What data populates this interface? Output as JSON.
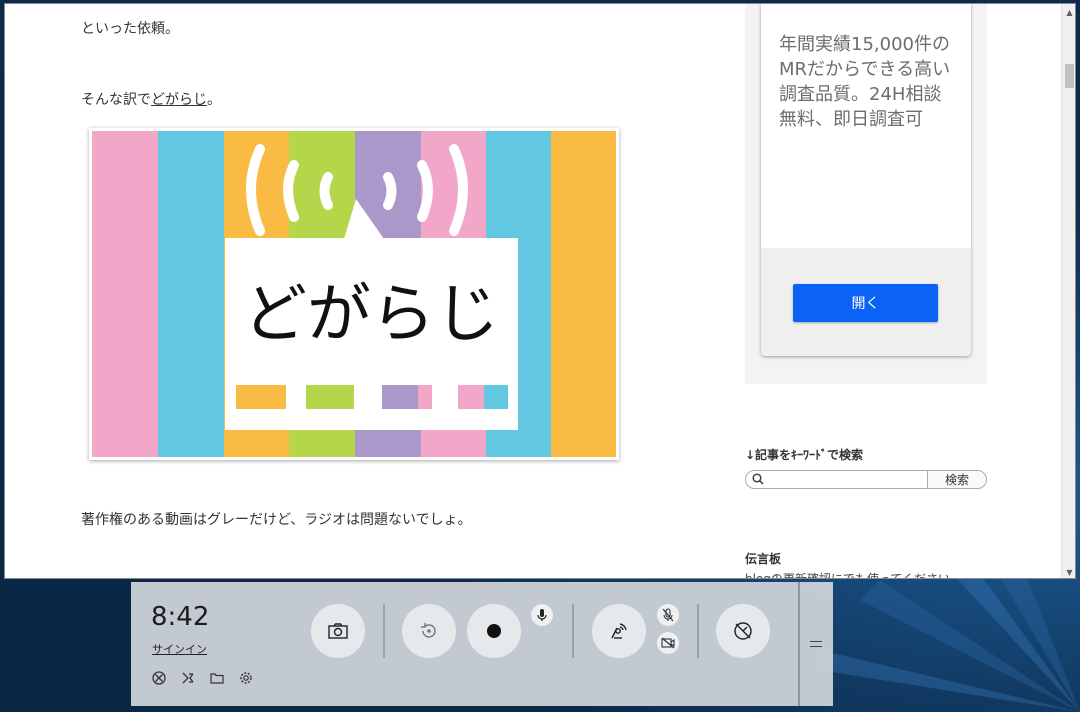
{
  "article": {
    "line1": "といった依頼。",
    "line2_prefix": "そんな訳で",
    "line2_link": "どがらじ",
    "line2_suffix": "。",
    "logo_text": "どがらじ",
    "line3": "著作権のある動画はグレーだけど、ラジオは問題ないでしょ。"
  },
  "ad": {
    "text": "年間実績15,000件のMRだからできる高い調査品質。24H相談無料、即日調査可",
    "button_label": "開く"
  },
  "sidebar": {
    "search_heading": "↓記事をｷｰﾜｰﾄﾞで検索",
    "search_placeholder": "",
    "search_button": "検索",
    "board_heading": "伝言板",
    "board_text": "blogの更新確認にでも使ってください"
  },
  "gamebar": {
    "time": "8:42",
    "signin": "サインイン"
  },
  "colors": {
    "stripe_pink": "#f2a7c8",
    "stripe_cyan": "#62c8e1",
    "stripe_orange": "#f9bb44",
    "stripe_green": "#b5d54b",
    "stripe_purple": "#a998c9",
    "ad_button": "#0b63f6"
  }
}
